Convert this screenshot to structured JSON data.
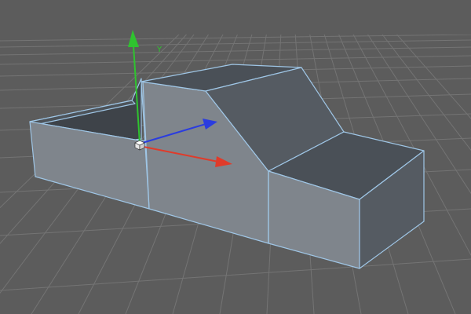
{
  "viewport": {
    "background_color": "#5c5c5c",
    "grid_color": "#747474",
    "horizon_color": "#6a6a6a"
  },
  "model": {
    "face_light_color": "#7f858c",
    "face_side_color": "#757b82",
    "face_dark_color": "#555b62",
    "face_top_color": "#4a5057",
    "inner_color": "#3e4349",
    "edge_color": "#9fc6e6"
  },
  "gizmo": {
    "y_axis_label": "Y",
    "y_axis_color": "#2fc32f",
    "x_axis_color": "#e03b2a",
    "z_axis_color": "#2a3ce0",
    "pivot_icon": "pivot-cube-icon"
  }
}
